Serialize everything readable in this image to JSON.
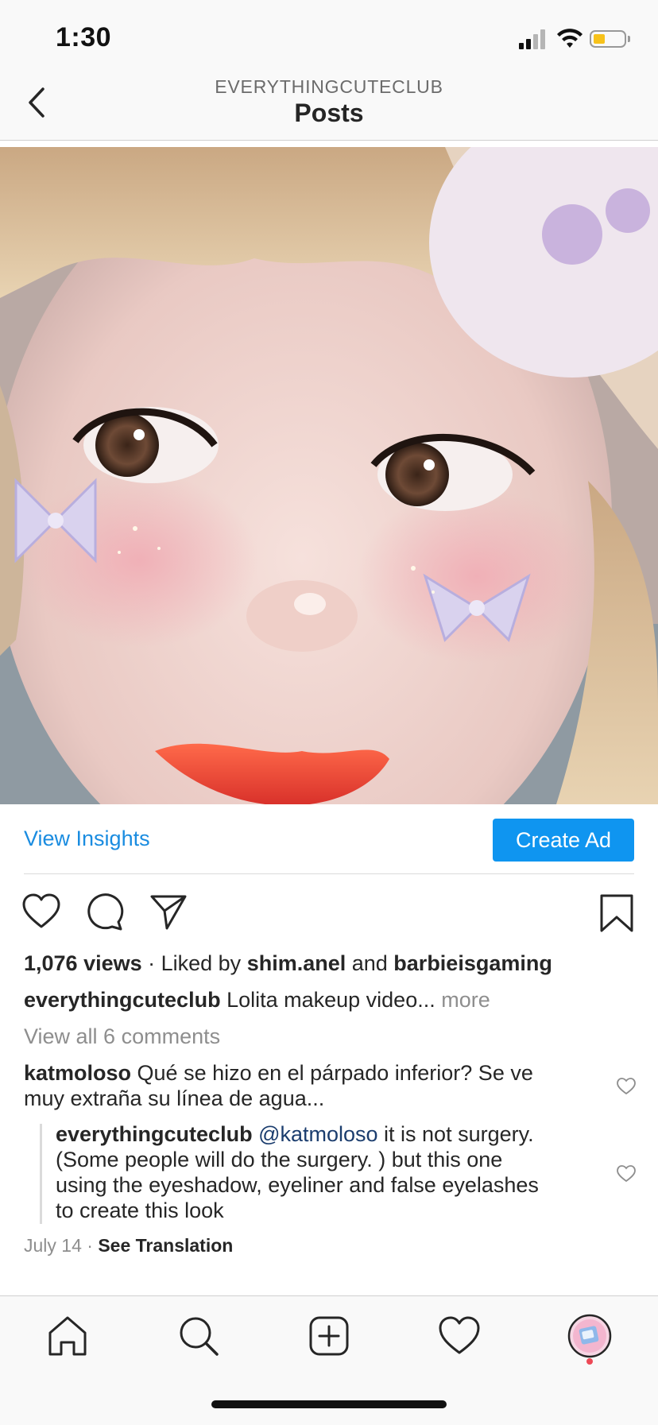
{
  "status_bar": {
    "time": "1:30",
    "icons": [
      "signal-icon",
      "wifi-icon",
      "battery-icon"
    ],
    "battery_color": "#f7c21b"
  },
  "nav": {
    "subtitle": "EVERYTHINGCUTECLUB",
    "title": "Posts",
    "back_icon": "chevron-left-icon"
  },
  "post": {
    "media_icon": "video-thumbnail",
    "view_insights": "View Insights",
    "create_ad": "Create Ad",
    "actions": [
      "heart-icon",
      "comment-icon",
      "share-icon",
      "bookmark-icon"
    ],
    "views": "1,076 views",
    "liked_by_sep": " · Liked by ",
    "liked_user_1": "shim.anel",
    "liked_and": " and ",
    "liked_user_2": "barbieisgaming",
    "caption_user": "everythingcuteclub",
    "caption_text": " Lolita makeup video... ",
    "caption_more": "more",
    "view_all_comments": "View all 6 comments"
  },
  "comments": [
    {
      "user": "katmoloso",
      "text_line_1": " Qué se hizo en el párpado inferior? Se ve",
      "text_line_2": "muy extraña su línea de agua..."
    },
    {
      "user": "everythingcuteclub",
      "mention": " @katmoloso",
      "text_line_1": " it is not surgery.",
      "text_line_2": "(Some people will do the surgery. )  but this one",
      "text_line_3": "using the eyeshadow, eyeliner and false eyelashes",
      "text_line_4": "to create this look"
    }
  ],
  "meta": {
    "date": "July 14",
    "separator": " · ",
    "see_translation": "See Translation"
  },
  "tab_bar": {
    "tabs": [
      "home-icon",
      "search-icon",
      "new-post-icon",
      "activity-heart-icon",
      "profile-avatar"
    ],
    "notification_dot_color": "#ed4956"
  },
  "colors": {
    "accent_blue": "#0f95f0",
    "link_blue": "#1a8ce0",
    "muted_gray": "#8e8e8e"
  }
}
